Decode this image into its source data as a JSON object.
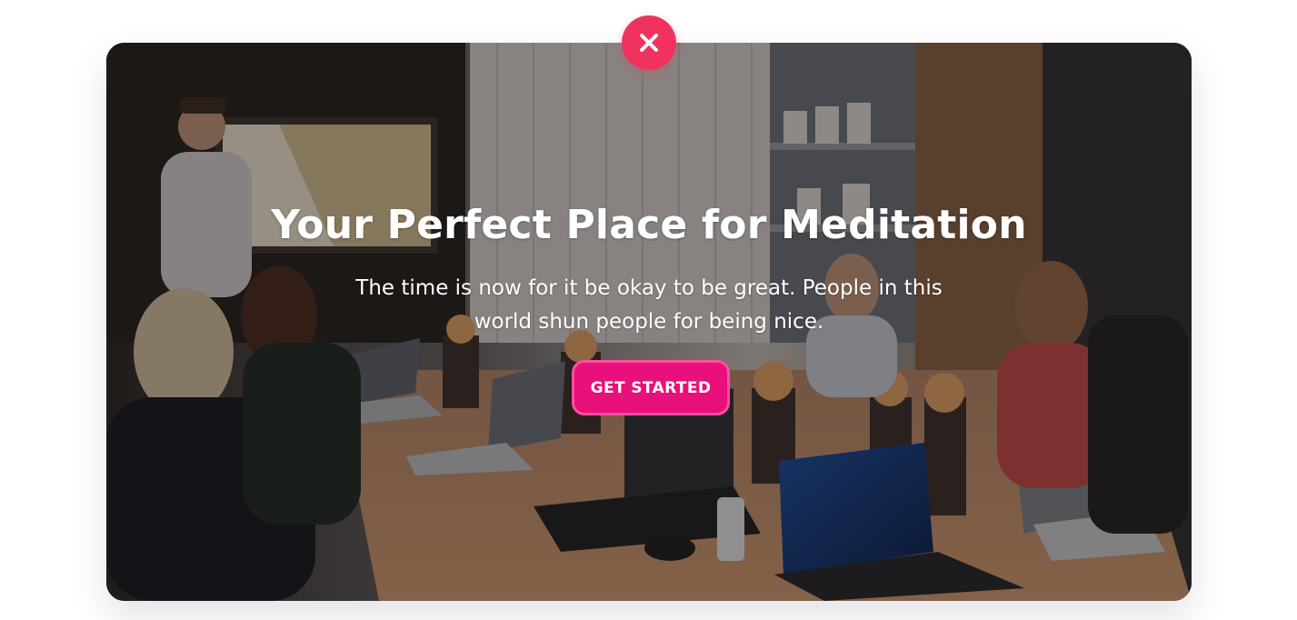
{
  "modal": {
    "title": "Your Perfect Place for Meditation",
    "subtitle": "The time is now for it be okay to be great. People in this world shun people for being nice.",
    "cta_label": "GET STARTED",
    "close_icon": "close-icon",
    "background_image": "people-in-conference-room-meeting-photo"
  },
  "colors": {
    "accent": "#e8107a",
    "close_button": "#f0325e",
    "title_text": "#ffffff"
  }
}
